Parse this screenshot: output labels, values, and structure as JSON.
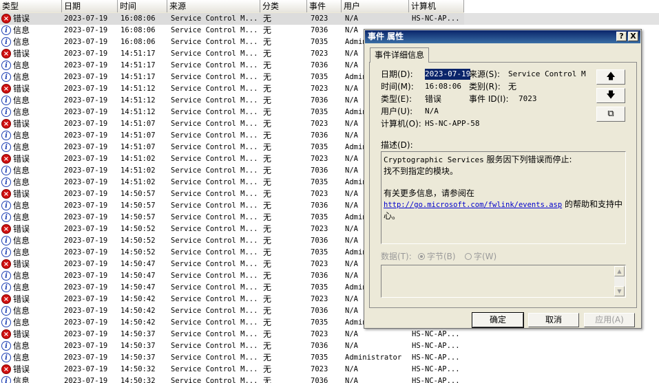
{
  "columns": [
    "类型",
    "日期",
    "时间",
    "来源",
    "分类",
    "事件",
    "用户",
    "计算机"
  ],
  "rows": [
    {
      "type": "错误",
      "kind": "err",
      "date": "2023-07-19",
      "time": "16:08:06",
      "source": "Service Control M...",
      "cat": "无",
      "event": "7023",
      "user": "N/A",
      "comp": "HS-NC-AP..."
    },
    {
      "type": "信息",
      "kind": "info",
      "date": "2023-07-19",
      "time": "16:08:06",
      "source": "Service Control M...",
      "cat": "无",
      "event": "7036",
      "user": "N/A",
      "comp": ""
    },
    {
      "type": "信息",
      "kind": "info",
      "date": "2023-07-19",
      "time": "16:08:06",
      "source": "Service Control M...",
      "cat": "无",
      "event": "7035",
      "user": "Admin",
      "comp": ""
    },
    {
      "type": "错误",
      "kind": "err",
      "date": "2023-07-19",
      "time": "14:51:17",
      "source": "Service Control M...",
      "cat": "无",
      "event": "7023",
      "user": "N/A",
      "comp": ""
    },
    {
      "type": "信息",
      "kind": "info",
      "date": "2023-07-19",
      "time": "14:51:17",
      "source": "Service Control M...",
      "cat": "无",
      "event": "7036",
      "user": "N/A",
      "comp": ""
    },
    {
      "type": "信息",
      "kind": "info",
      "date": "2023-07-19",
      "time": "14:51:17",
      "source": "Service Control M...",
      "cat": "无",
      "event": "7035",
      "user": "Admin",
      "comp": ""
    },
    {
      "type": "错误",
      "kind": "err",
      "date": "2023-07-19",
      "time": "14:51:12",
      "source": "Service Control M...",
      "cat": "无",
      "event": "7023",
      "user": "N/A",
      "comp": ""
    },
    {
      "type": "信息",
      "kind": "info",
      "date": "2023-07-19",
      "time": "14:51:12",
      "source": "Service Control M...",
      "cat": "无",
      "event": "7036",
      "user": "N/A",
      "comp": ""
    },
    {
      "type": "信息",
      "kind": "info",
      "date": "2023-07-19",
      "time": "14:51:12",
      "source": "Service Control M...",
      "cat": "无",
      "event": "7035",
      "user": "Admin",
      "comp": ""
    },
    {
      "type": "错误",
      "kind": "err",
      "date": "2023-07-19",
      "time": "14:51:07",
      "source": "Service Control M...",
      "cat": "无",
      "event": "7023",
      "user": "N/A",
      "comp": ""
    },
    {
      "type": "信息",
      "kind": "info",
      "date": "2023-07-19",
      "time": "14:51:07",
      "source": "Service Control M...",
      "cat": "无",
      "event": "7036",
      "user": "N/A",
      "comp": ""
    },
    {
      "type": "信息",
      "kind": "info",
      "date": "2023-07-19",
      "time": "14:51:07",
      "source": "Service Control M...",
      "cat": "无",
      "event": "7035",
      "user": "Admin",
      "comp": ""
    },
    {
      "type": "错误",
      "kind": "err",
      "date": "2023-07-19",
      "time": "14:51:02",
      "source": "Service Control M...",
      "cat": "无",
      "event": "7023",
      "user": "N/A",
      "comp": ""
    },
    {
      "type": "信息",
      "kind": "info",
      "date": "2023-07-19",
      "time": "14:51:02",
      "source": "Service Control M...",
      "cat": "无",
      "event": "7036",
      "user": "N/A",
      "comp": ""
    },
    {
      "type": "信息",
      "kind": "info",
      "date": "2023-07-19",
      "time": "14:51:02",
      "source": "Service Control M...",
      "cat": "无",
      "event": "7035",
      "user": "Admin",
      "comp": ""
    },
    {
      "type": "错误",
      "kind": "err",
      "date": "2023-07-19",
      "time": "14:50:57",
      "source": "Service Control M...",
      "cat": "无",
      "event": "7023",
      "user": "N/A",
      "comp": ""
    },
    {
      "type": "信息",
      "kind": "info",
      "date": "2023-07-19",
      "time": "14:50:57",
      "source": "Service Control M...",
      "cat": "无",
      "event": "7036",
      "user": "N/A",
      "comp": ""
    },
    {
      "type": "信息",
      "kind": "info",
      "date": "2023-07-19",
      "time": "14:50:57",
      "source": "Service Control M...",
      "cat": "无",
      "event": "7035",
      "user": "Admin",
      "comp": ""
    },
    {
      "type": "错误",
      "kind": "err",
      "date": "2023-07-19",
      "time": "14:50:52",
      "source": "Service Control M...",
      "cat": "无",
      "event": "7023",
      "user": "N/A",
      "comp": ""
    },
    {
      "type": "信息",
      "kind": "info",
      "date": "2023-07-19",
      "time": "14:50:52",
      "source": "Service Control M...",
      "cat": "无",
      "event": "7036",
      "user": "N/A",
      "comp": ""
    },
    {
      "type": "信息",
      "kind": "info",
      "date": "2023-07-19",
      "time": "14:50:52",
      "source": "Service Control M...",
      "cat": "无",
      "event": "7035",
      "user": "Admin",
      "comp": ""
    },
    {
      "type": "错误",
      "kind": "err",
      "date": "2023-07-19",
      "time": "14:50:47",
      "source": "Service Control M...",
      "cat": "无",
      "event": "7023",
      "user": "N/A",
      "comp": ""
    },
    {
      "type": "信息",
      "kind": "info",
      "date": "2023-07-19",
      "time": "14:50:47",
      "source": "Service Control M...",
      "cat": "无",
      "event": "7036",
      "user": "N/A",
      "comp": ""
    },
    {
      "type": "信息",
      "kind": "info",
      "date": "2023-07-19",
      "time": "14:50:47",
      "source": "Service Control M...",
      "cat": "无",
      "event": "7035",
      "user": "Admin",
      "comp": ""
    },
    {
      "type": "错误",
      "kind": "err",
      "date": "2023-07-19",
      "time": "14:50:42",
      "source": "Service Control M...",
      "cat": "无",
      "event": "7023",
      "user": "N/A",
      "comp": ""
    },
    {
      "type": "信息",
      "kind": "info",
      "date": "2023-07-19",
      "time": "14:50:42",
      "source": "Service Control M...",
      "cat": "无",
      "event": "7036",
      "user": "N/A",
      "comp": ""
    },
    {
      "type": "信息",
      "kind": "info",
      "date": "2023-07-19",
      "time": "14:50:42",
      "source": "Service Control M...",
      "cat": "无",
      "event": "7035",
      "user": "Admin",
      "comp": ""
    },
    {
      "type": "错误",
      "kind": "err",
      "date": "2023-07-19",
      "time": "14:50:37",
      "source": "Service Control M...",
      "cat": "无",
      "event": "7023",
      "user": "N/A",
      "comp": "HS-NC-AP..."
    },
    {
      "type": "信息",
      "kind": "info",
      "date": "2023-07-19",
      "time": "14:50:37",
      "source": "Service Control M...",
      "cat": "无",
      "event": "7036",
      "user": "N/A",
      "comp": "HS-NC-AP..."
    },
    {
      "type": "信息",
      "kind": "info",
      "date": "2023-07-19",
      "time": "14:50:37",
      "source": "Service Control M...",
      "cat": "无",
      "event": "7035",
      "user": "Administrator",
      "comp": "HS-NC-AP..."
    },
    {
      "type": "错误",
      "kind": "err",
      "date": "2023-07-19",
      "time": "14:50:32",
      "source": "Service Control M...",
      "cat": "无",
      "event": "7023",
      "user": "N/A",
      "comp": "HS-NC-AP..."
    },
    {
      "type": "信息",
      "kind": "info",
      "date": "2023-07-19",
      "time": "14:50:32",
      "source": "Service Control M...",
      "cat": "无",
      "event": "7036",
      "user": "N/A",
      "comp": "HS-NC-AP..."
    }
  ],
  "dialog": {
    "title": "事件 属性",
    "help_btn": "?",
    "close_btn": "X",
    "tab": "事件详细信息",
    "date_label": "日期(D):",
    "date_value": "2023-07-19",
    "source_label": "来源(S):",
    "source_value": "Service Control M",
    "time_label": "时间(M):",
    "time_value": "16:08:06",
    "category_label": "类别(R):",
    "category_value": "无",
    "type_label": "类型(E):",
    "type_value": "错误",
    "eventid_label": "事件 ID(I):",
    "eventid_value": "7023",
    "user_label": "用户(U):",
    "user_value": "N/A",
    "computer_label": "计算机(O):",
    "computer_value": "HS-NC-APP-58",
    "up_arrow": "🡅",
    "down_arrow": "🡇",
    "copy_glyph": "⧉",
    "desc_label": "描述(D):",
    "desc_line1_mono": "Cryptographic Services",
    "desc_line1_rest": " 服务因下列错误而停止:",
    "desc_line2": "找不到指定的模块。",
    "desc_line3": "有关更多信息，请参阅在",
    "desc_link": "http://go.microsoft.com/fwlink/events.asp",
    "desc_line4_rest": " 的帮助和支持中",
    "desc_line5": "心。",
    "data_label": "数据(T):",
    "radio_bytes": "字节(B)",
    "radio_words": "字(W)",
    "scroll_up": "▲",
    "scroll_down": "▼",
    "ok": "确定",
    "cancel": "取消",
    "apply": "应用(A)"
  }
}
